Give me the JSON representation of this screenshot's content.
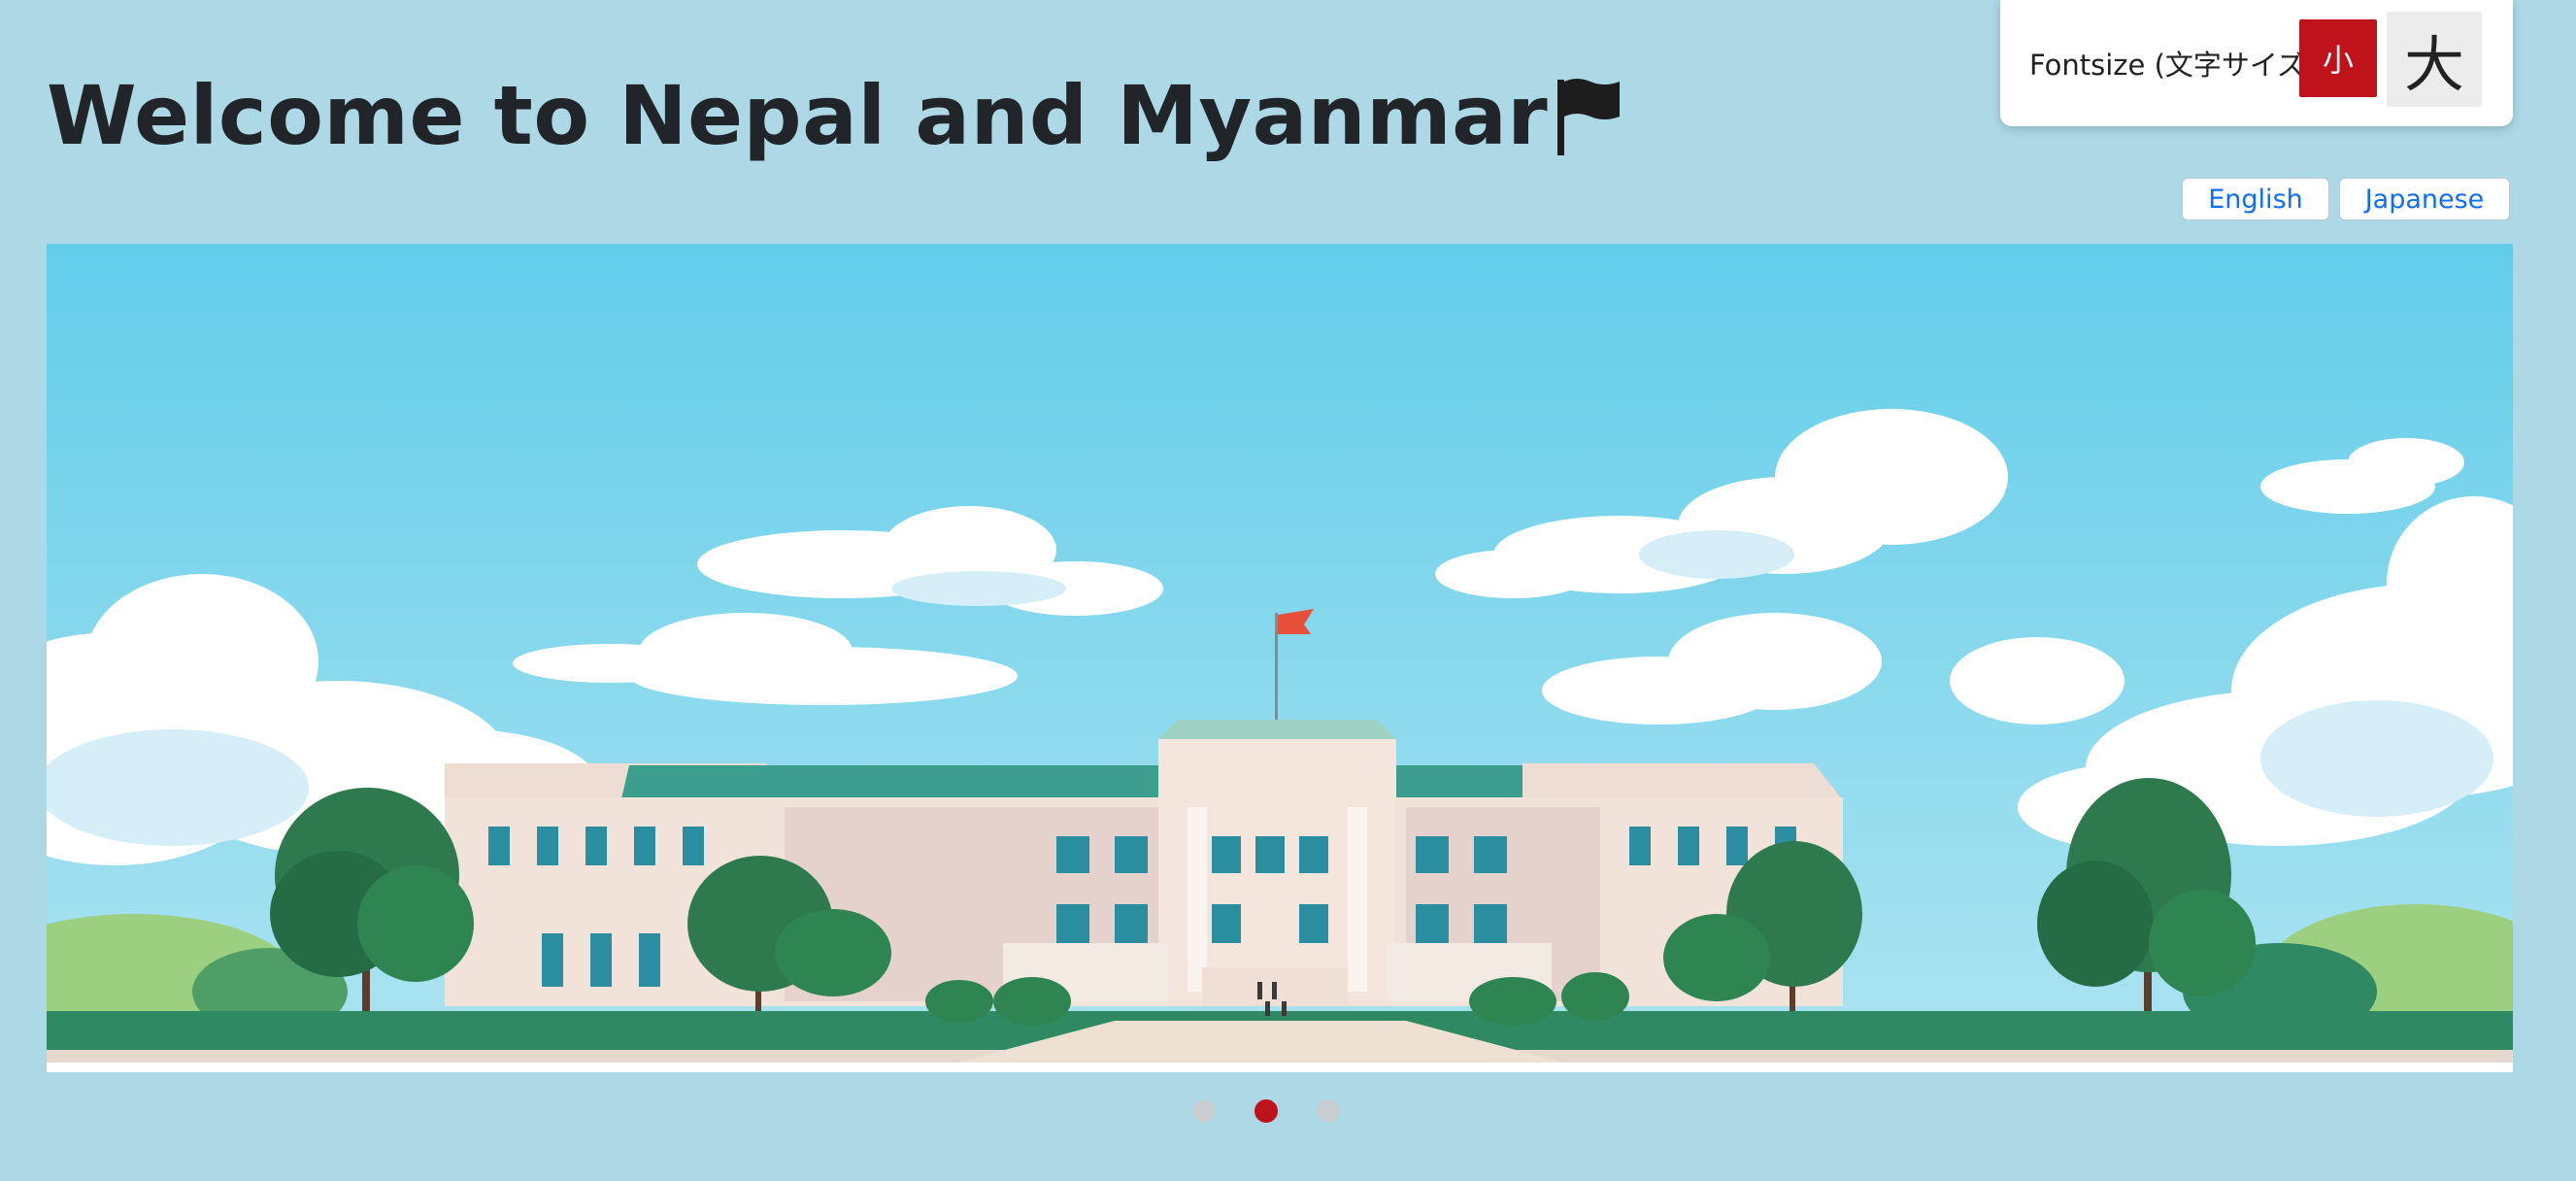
{
  "header": {
    "title": "Welcome to Nepal and Myanmar"
  },
  "fontsize": {
    "label": "Fontsize (文字サイズ)",
    "small_label": "小",
    "large_label": "大"
  },
  "language": {
    "english_label": "English",
    "japanese_label": "Japanese"
  },
  "carousel": {
    "slide_count": 3,
    "active_index": 1
  },
  "colors": {
    "background": "#add8e6",
    "accent_red": "#c0121b",
    "link_blue": "#0d6efd"
  }
}
